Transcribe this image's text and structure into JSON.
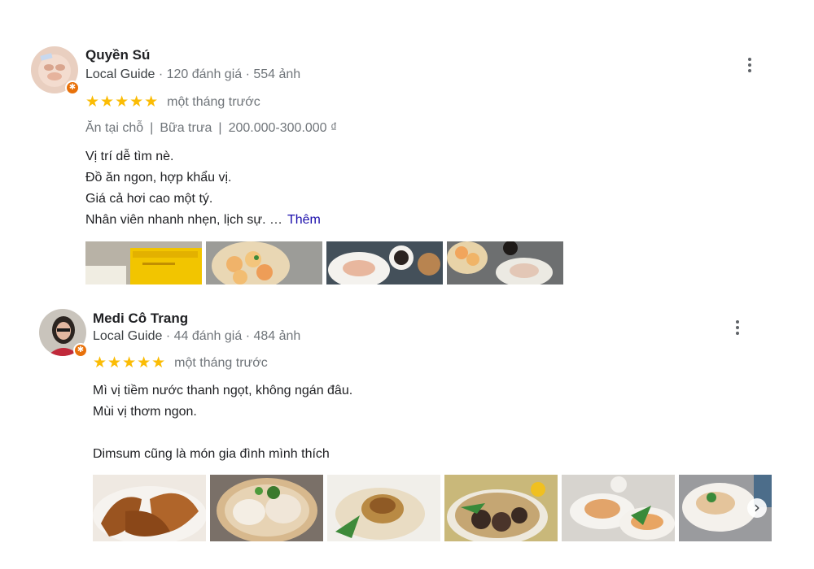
{
  "reviews": [
    {
      "name": "Quyền Sú",
      "local_guide": "Local Guide",
      "meta": " · 120 đánh giá · 554 ảnh",
      "stars": "★★★★★",
      "rating": 5,
      "date": "một tháng trước",
      "attributes": [
        "Ăn tại chỗ",
        "Bữa trưa",
        "200.000-300.000 ₫"
      ],
      "attr_separator": "|",
      "text_lines": [
        "Vị trí dễ tìm nè.",
        "Đồ ăn ngon, hợp khẩu vị.",
        "Giá cả hơi cao một tý.",
        "Nhân viên nhanh nhẹn, lịch sự. …"
      ],
      "more_label": "Thêm",
      "photo_count": 4
    },
    {
      "name": "Medi Cô Trang",
      "local_guide": "Local Guide",
      "meta": " · 44 đánh giá · 484 ảnh",
      "stars": "★★★★★",
      "rating": 5,
      "date": "một tháng trước",
      "text_lines": [
        "Mì vị tiềm nước thanh ngọt, không ngán đâu.",
        "Mùi vị thơm ngon.",
        "",
        "Dimsum cũng là món gia đình mình thích"
      ],
      "photo_count": 6,
      "next_arrow": "›"
    }
  ],
  "icons": {
    "kebab": "more-vert-icon",
    "badge": "local-guide-badge-icon",
    "star": "star-icon"
  },
  "colors": {
    "star": "#fbbc04",
    "badge": "#e8710a",
    "link": "#1a0dab",
    "muted": "#70757a"
  }
}
